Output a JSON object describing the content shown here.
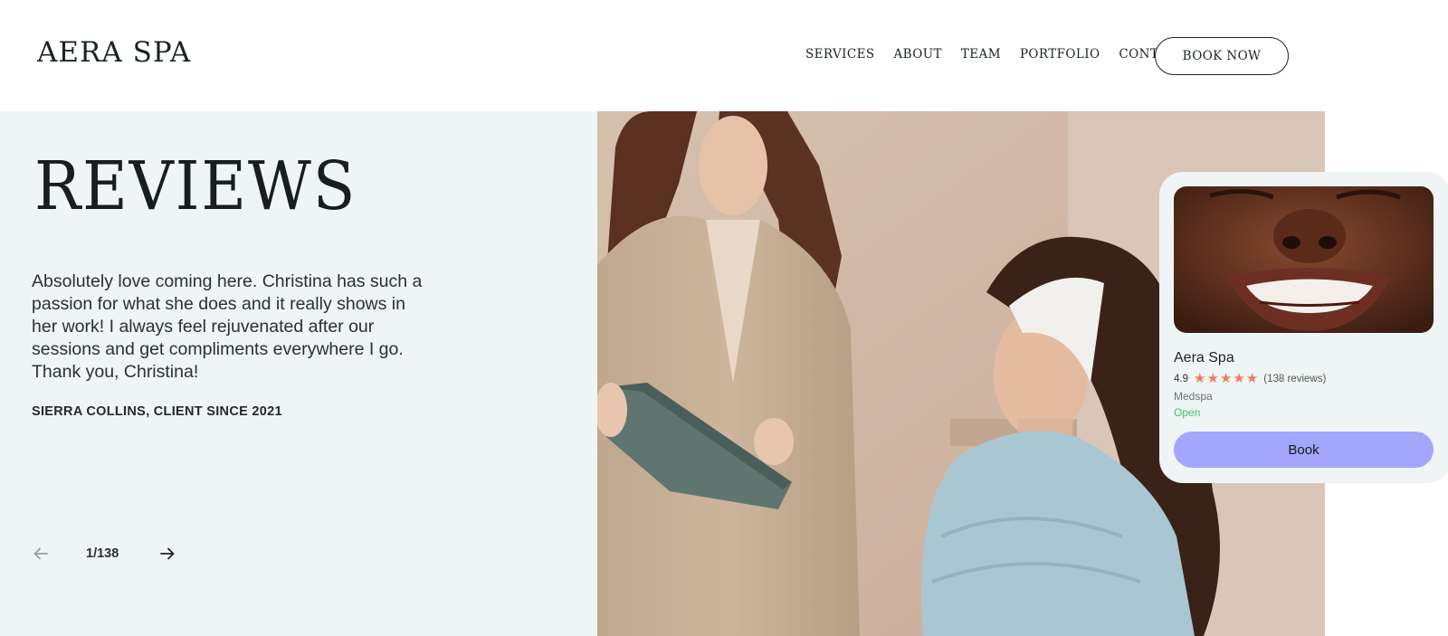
{
  "header": {
    "logo": "AERA SPA",
    "nav": [
      {
        "label": "SERVICES"
      },
      {
        "label": "ABOUT"
      },
      {
        "label": "TEAM"
      },
      {
        "label": "PORTFOLIO"
      },
      {
        "label": "CONTACT"
      }
    ],
    "cta_label": "BOOK NOW"
  },
  "reviews": {
    "title": "REVIEWS",
    "quote": "Absolutely love coming here. Christina has such a passion for what she does and it really shows in her work! I always feel rejuvenated after our sessions and get compliments everywhere I go. Thank you, Christina!",
    "author": "SIERRA COLLINS, CLIENT SINCE 2021",
    "pager": {
      "current_of_total": "1/138"
    }
  },
  "card": {
    "name": "Aera Spa",
    "rating": "4.9",
    "stars": 5,
    "review_count": "(138 reviews)",
    "category": "Medspa",
    "status": "Open",
    "book_label": "Book"
  },
  "colors": {
    "panel_bg": "#eef5f4",
    "star": "#f27b5d",
    "open_status": "#3fbf72",
    "book_button": "#a3a6fb"
  }
}
